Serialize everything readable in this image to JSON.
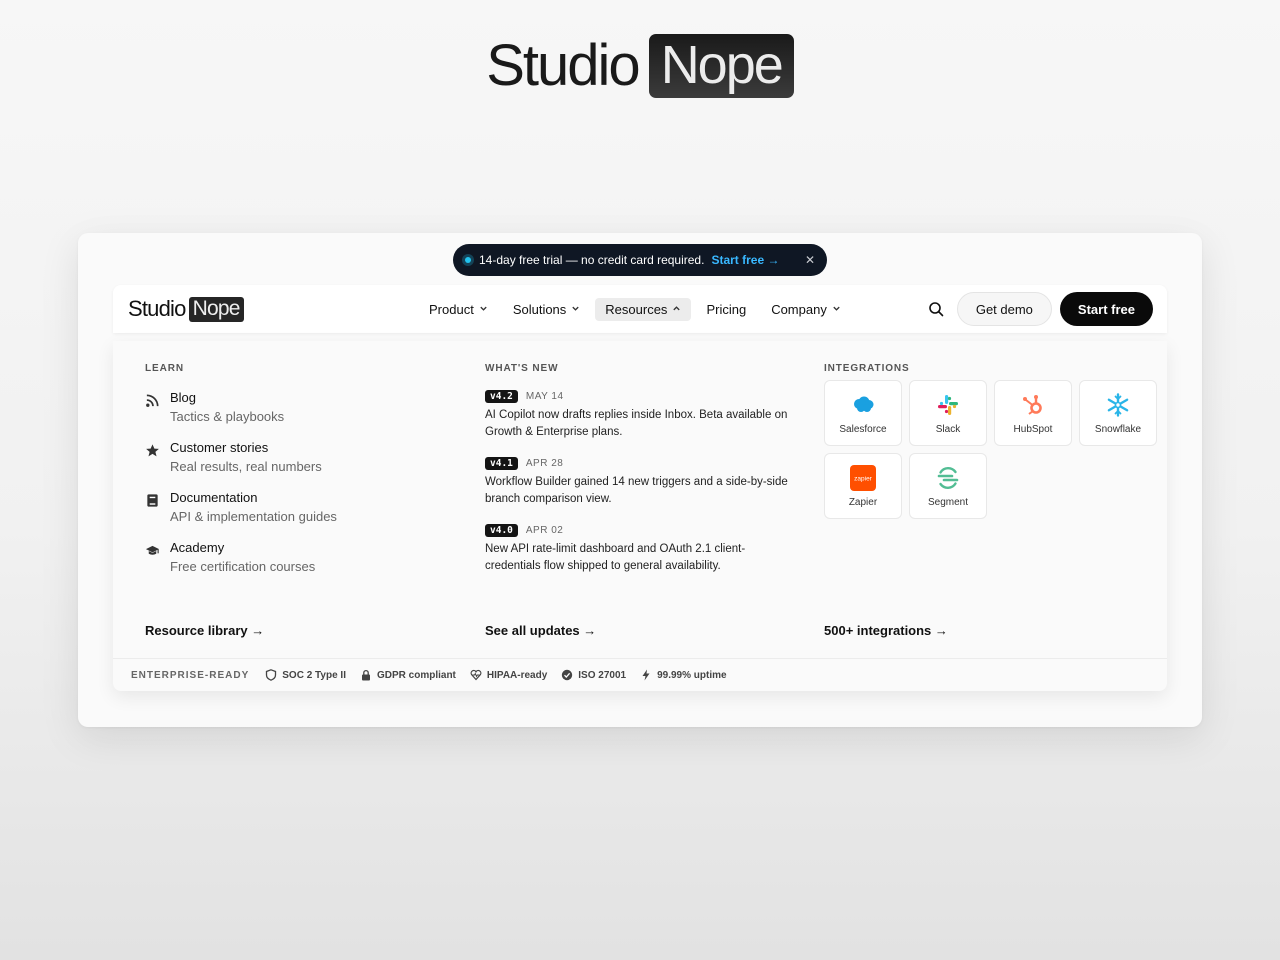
{
  "brand": {
    "word1": "Studio",
    "word2": "Nope"
  },
  "announcement": {
    "text": "14-day free trial — no credit card required.",
    "cta": "Start free →",
    "close": "✕"
  },
  "nav": {
    "logo_word1": "Studio",
    "logo_word2": "Nope",
    "items": [
      {
        "label": "Product",
        "chevron": "⌄"
      },
      {
        "label": "Solutions",
        "chevron": "⌄"
      },
      {
        "label": "Resources",
        "chevron": "⌃",
        "active": true
      },
      {
        "label": "Pricing",
        "chevron": ""
      },
      {
        "label": "Company",
        "chevron": "⌄"
      }
    ],
    "search_icon": "search-icon",
    "get_demo": "Get demo",
    "start_free": "Start free"
  },
  "learn": {
    "heading": "LEARN",
    "items": [
      {
        "icon": "rss-icon",
        "title": "Blog",
        "sub": "Tactics & playbooks"
      },
      {
        "icon": "star-icon",
        "title": "Customer stories",
        "sub": "Real results, real numbers"
      },
      {
        "icon": "book-icon",
        "title": "Documentation",
        "sub": "API & implementation guides"
      },
      {
        "icon": "graduation-cap-icon",
        "title": "Academy",
        "sub": "Free certification courses"
      }
    ],
    "footer_link": "Resource library →"
  },
  "whats_new": {
    "heading": "WHAT'S NEW",
    "items": [
      {
        "version": "v4.2",
        "date": "MAY 14",
        "text": "AI Copilot now drafts replies inside Inbox. Beta available on Growth & Enterprise plans."
      },
      {
        "version": "v4.1",
        "date": "APR 28",
        "text": "Workflow Builder gained 14 new triggers and a side-by-side branch comparison view."
      },
      {
        "version": "v4.0",
        "date": "APR 02",
        "text": "New API rate-limit dashboard and OAuth 2.1 client-credentials flow shipped to general availability."
      }
    ],
    "footer_link": "See all updates →"
  },
  "integrations": {
    "heading": "INTEGRATIONS",
    "tiles": [
      {
        "name": "Salesforce",
        "icon": "salesforce-logo"
      },
      {
        "name": "Slack",
        "icon": "slack-logo"
      },
      {
        "name": "HubSpot",
        "icon": "hubspot-logo"
      },
      {
        "name": "Snowflake",
        "icon": "snowflake-logo"
      },
      {
        "name": "Zapier",
        "icon": "zapier-logo",
        "logo_text": "zapier"
      },
      {
        "name": "Segment",
        "icon": "segment-logo"
      }
    ],
    "footer_link": "500+ integrations →"
  },
  "trust": {
    "label": "ENTERPRISE-READY",
    "badges": [
      {
        "icon": "shield-icon",
        "text": "SOC 2 Type II"
      },
      {
        "icon": "lock-icon",
        "text": "GDPR compliant"
      },
      {
        "icon": "heart-pulse-icon",
        "text": "HIPAA-ready"
      },
      {
        "icon": "check-circle-icon",
        "text": "ISO 27001"
      },
      {
        "icon": "bolt-icon",
        "text": "99.99% uptime"
      }
    ]
  },
  "colors": {
    "accent_cyan": "#22c3ee",
    "cta_blue": "#39b8ff",
    "dark": "#0a0a0a",
    "salesforce": "#1aa0e0",
    "hubspot": "#ff7a59",
    "snowflake": "#29b5e8",
    "zapier": "#ff4f00",
    "segment": "#52bd94"
  }
}
